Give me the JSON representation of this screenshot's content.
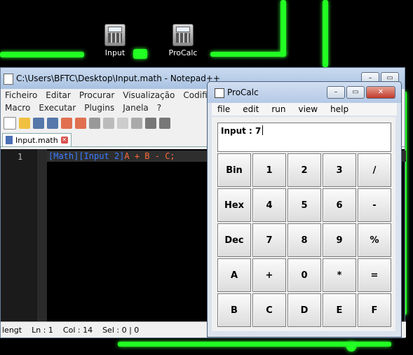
{
  "desktop": {
    "icons": [
      {
        "label": "Input"
      },
      {
        "label": "ProCalc"
      }
    ]
  },
  "notepad": {
    "title": "C:\\Users\\BFTC\\Desktop\\Input.math - Notepad++",
    "menu1": [
      "Ficheiro",
      "Editar",
      "Procurar",
      "Visualização",
      "Codificação"
    ],
    "menu2": [
      "Macro",
      "Executar",
      "Plugins",
      "Janela",
      "?"
    ],
    "tab_label": "Input.math",
    "line_number": "1",
    "code": {
      "part1": "[Math]",
      "part2": "[Input 2]",
      "part3": "A + B - C;"
    },
    "status": {
      "length": "lengt",
      "ln": "Ln : 1",
      "col": "Col : 14",
      "sel": "Sel : 0 | 0"
    }
  },
  "procalc": {
    "title": "ProCalc",
    "menu": [
      "file",
      "edit",
      "run",
      "view",
      "help"
    ],
    "display": "Input : 7",
    "keys": [
      "Bin",
      "1",
      "2",
      "3",
      "/",
      "Hex",
      "4",
      "5",
      "6",
      "-",
      "Dec",
      "7",
      "8",
      "9",
      "%",
      "A",
      "+",
      "0",
      "*",
      "=",
      "B",
      "C",
      "D",
      "E",
      "F"
    ]
  },
  "colors": {
    "neon": "#22ff22",
    "code_bracket": "#00c8c8",
    "code_keyword": "#3a7cff",
    "code_text": "#ff6a3a"
  }
}
